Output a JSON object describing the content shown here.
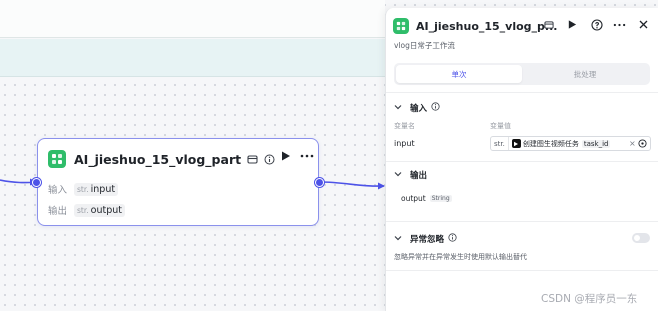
{
  "node": {
    "title": "AI_jieshuo_15_vlog_part",
    "rows": [
      {
        "label": "输入",
        "type": "str.",
        "name": "input"
      },
      {
        "label": "输出",
        "type": "str.",
        "name": "output"
      }
    ]
  },
  "panel": {
    "title": "AI_jieshuo_15_vlog_p...",
    "description": "vlog日常子工作流",
    "tabs": [
      "单次",
      "批处理"
    ],
    "input_section": {
      "title": "输入",
      "col_name": "变量名",
      "col_value": "变量值",
      "param_name": "input",
      "ref_type": "str.",
      "ref_node": "创建图生视频任务",
      "ref_var": "task_id",
      "clear": "×"
    },
    "output_section": {
      "title": "输出",
      "param_name": "output",
      "param_type": "String"
    },
    "error_section": {
      "title": "异常忽略",
      "description": "忽略异常并在异常发生时使用默认输出替代"
    }
  },
  "watermark": "CSDN @程序员一东",
  "colors": {
    "accent": "#4d53e8",
    "node_icon": "#2fbd6a",
    "node_border": "#8b91ec"
  },
  "icons": [
    "workflow-app-icon",
    "save-icon",
    "info-icon",
    "play-icon",
    "more-icon",
    "help-icon",
    "close-icon",
    "chevron-down-icon",
    "var-picker-icon",
    "toggle-switch"
  ]
}
